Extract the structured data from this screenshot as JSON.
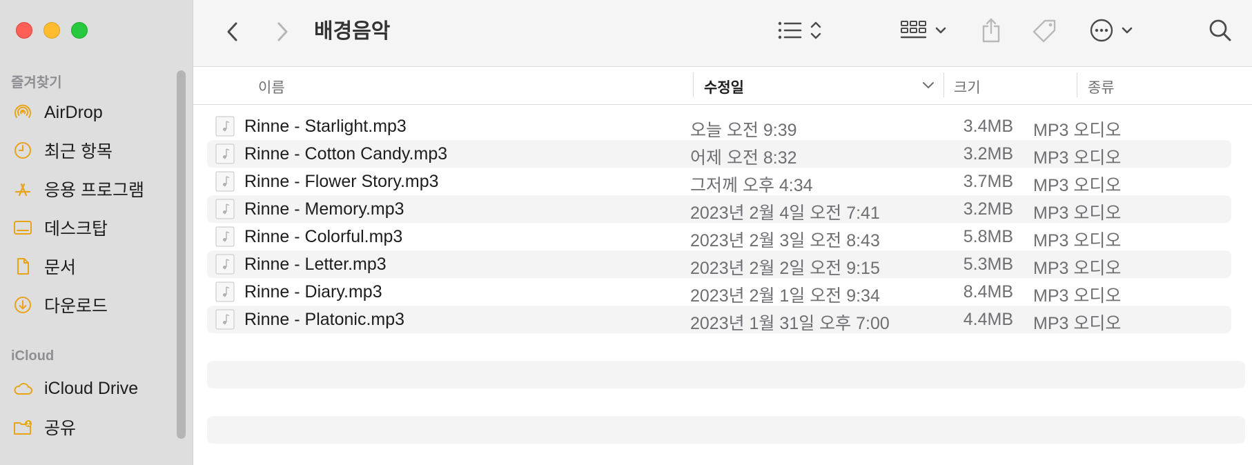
{
  "window": {
    "title": "배경음악"
  },
  "sidebar": {
    "favorites_label": "즐겨찾기",
    "favorites": [
      {
        "label": "AirDrop",
        "icon": "airdrop-icon"
      },
      {
        "label": "최근 항목",
        "icon": "clock-icon"
      },
      {
        "label": "응용 프로그램",
        "icon": "applications-icon"
      },
      {
        "label": "데스크탑",
        "icon": "desktop-icon"
      },
      {
        "label": "문서",
        "icon": "document-icon"
      },
      {
        "label": "다운로드",
        "icon": "download-icon"
      }
    ],
    "icloud_label": "iCloud",
    "icloud": [
      {
        "label": "iCloud Drive",
        "icon": "cloud-icon"
      },
      {
        "label": "공유",
        "icon": "shared-folder-icon"
      }
    ],
    "accent_color": "#e8a317"
  },
  "toolbar": {
    "back_icon": "chevron-left-icon",
    "forward_icon": "chevron-right-icon",
    "view_icon": "list-view-icon",
    "group_icon": "grid-group-icon",
    "share_icon": "share-icon",
    "tag_icon": "tag-icon",
    "more_icon": "ellipsis-circle-icon",
    "search_icon": "search-icon"
  },
  "columns": {
    "name": "이름",
    "modified": "수정일",
    "size": "크기",
    "kind": "종류",
    "sort_column": "modified",
    "sort_direction": "descending"
  },
  "files": [
    {
      "name": "Rinne - Starlight.mp3",
      "modified": "오늘 오전 9:39",
      "size": "3.4MB",
      "kind": "MP3 오디오"
    },
    {
      "name": "Rinne - Cotton Candy.mp3",
      "modified": "어제 오전 8:32",
      "size": "3.2MB",
      "kind": "MP3 오디오"
    },
    {
      "name": "Rinne - Flower Story.mp3",
      "modified": "그저께 오후 4:34",
      "size": "3.7MB",
      "kind": "MP3 오디오"
    },
    {
      "name": "Rinne - Memory.mp3",
      "modified": "2023년 2월 4일 오전 7:41",
      "size": "3.2MB",
      "kind": "MP3 오디오"
    },
    {
      "name": "Rinne - Colorful.mp3",
      "modified": "2023년 2월 3일 오전 8:43",
      "size": "5.8MB",
      "kind": "MP3 오디오"
    },
    {
      "name": "Rinne - Letter.mp3",
      "modified": "2023년 2월 2일 오전 9:15",
      "size": "5.3MB",
      "kind": "MP3 오디오"
    },
    {
      "name": "Rinne - Diary.mp3",
      "modified": "2023년 2월 1일 오전 9:34",
      "size": "8.4MB",
      "kind": "MP3 오디오"
    },
    {
      "name": "Rinne - Platonic.mp3",
      "modified": "2023년 1월 31일 오후 7:00",
      "size": "4.4MB",
      "kind": "MP3 오디오"
    }
  ]
}
